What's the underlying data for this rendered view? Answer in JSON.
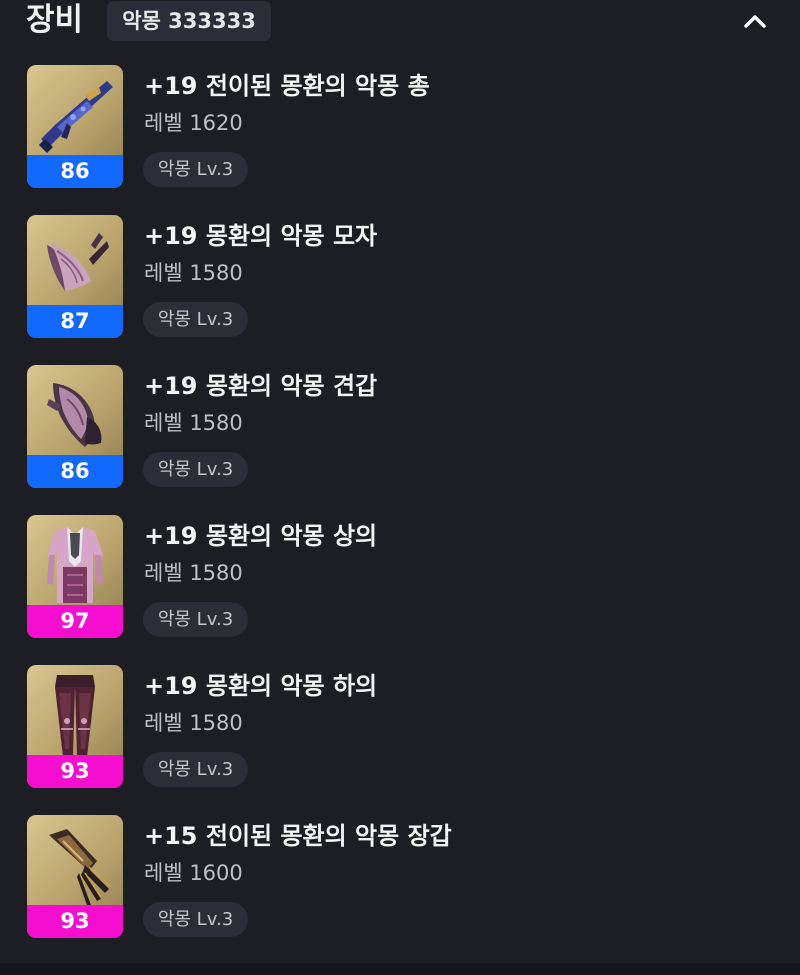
{
  "header": {
    "title": "장비",
    "set_badge": "악몽 333333",
    "collapse_icon": "chevron-up-icon"
  },
  "colors": {
    "background": "#1c1e24",
    "badge_background": "#2b2e36",
    "quality_blue": "#1169ff",
    "quality_pink": "#f50ecf"
  },
  "items": [
    {
      "name": "+19 전이된 몽환의 악몽 총",
      "level": "레벨 1620",
      "quality": "86",
      "quality_color": "blue",
      "grade": "악몽 Lv.3",
      "icon": "gun-icon"
    },
    {
      "name": "+19 몽환의 악몽 모자",
      "level": "레벨 1580",
      "quality": "87",
      "quality_color": "blue",
      "grade": "악몽 Lv.3",
      "icon": "helmet-icon"
    },
    {
      "name": "+19 몽환의 악몽 견갑",
      "level": "레벨 1580",
      "quality": "86",
      "quality_color": "blue",
      "grade": "악몽 Lv.3",
      "icon": "shoulder-armor-icon"
    },
    {
      "name": "+19 몽환의 악몽 상의",
      "level": "레벨 1580",
      "quality": "97",
      "quality_color": "pink",
      "grade": "악몽 Lv.3",
      "icon": "chest-armor-icon"
    },
    {
      "name": "+19 몽환의 악몽 하의",
      "level": "레벨 1580",
      "quality": "93",
      "quality_color": "pink",
      "grade": "악몽 Lv.3",
      "icon": "pants-icon"
    },
    {
      "name": "+15 전이된 몽환의 악몽 장갑",
      "level": "레벨 1600",
      "quality": "93",
      "quality_color": "pink",
      "grade": "악몽 Lv.3",
      "icon": "gloves-icon"
    }
  ]
}
